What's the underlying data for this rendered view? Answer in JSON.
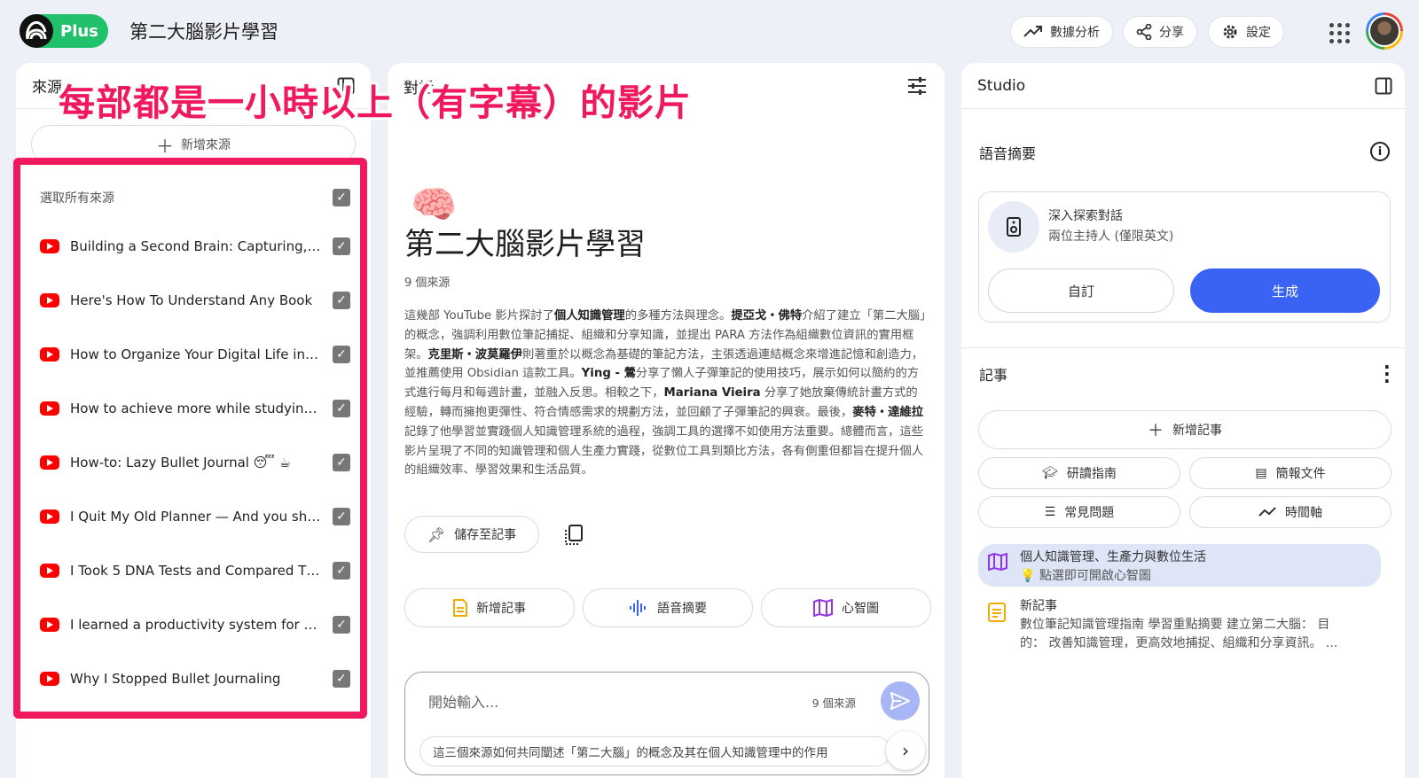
{
  "header": {
    "plan_badge": "Plus",
    "notebook_title": "第二大腦影片學習",
    "analytics_label": "數據分析",
    "share_label": "分享",
    "settings_label": "設定"
  },
  "overlay_caption": "每部都是一小時以上（有字幕）的影片",
  "sources_panel": {
    "title": "來源",
    "add_label": "新增來源",
    "select_all_label": "選取所有來源",
    "items": [
      {
        "label": "Building a Second Brain: Capturing, ...",
        "checked": true
      },
      {
        "label": "Here's How To Understand Any Book",
        "checked": true
      },
      {
        "label": "How to Organize Your Digital Life in S...",
        "checked": true
      },
      {
        "label": "How to achieve more while studying l...",
        "checked": true
      },
      {
        "label": "How-to: Lazy Bullet Journal 😴 ☕",
        "checked": true
      },
      {
        "label": "I Quit My Old Planner — And you sho...",
        "checked": true
      },
      {
        "label": "I Took 5 DNA Tests and Compared Th...",
        "checked": true
      },
      {
        "label": "I learned a productivity system for or...",
        "checked": true
      },
      {
        "label": "Why I Stopped Bullet Journaling",
        "checked": true
      }
    ]
  },
  "chat_panel": {
    "title": "對話",
    "emoji": "🧠",
    "notebook_title": "第二大腦影片學習",
    "source_count": "9 個來源",
    "summary_segments": [
      {
        "t": "這幾部 YouTube 影片探討了",
        "b": false
      },
      {
        "t": "個人知識管理",
        "b": true
      },
      {
        "t": "的多種方法與理念。",
        "b": false
      },
      {
        "t": "提亞戈・佛特",
        "b": true
      },
      {
        "t": "介紹了建立「第二大腦」的概念，強調利用數位筆記捕捉、組織和分享知識，並提出 PARA 方法作為組織數位資訊的實用框架。",
        "b": false
      },
      {
        "t": "克里斯・波莫羅伊",
        "b": true
      },
      {
        "t": "則著重於以概念為基礎的筆記方法，主張透過連結概念來增進記憶和創造力，並推薦使用 Obsidian 這款工具。",
        "b": false
      },
      {
        "t": "Ying - 鶯",
        "b": true
      },
      {
        "t": "分享了懶人子彈筆記的使用技巧，展示如何以簡約的方式進行每月和每週計畫，並融入反思。相較之下，",
        "b": false
      },
      {
        "t": "Mariana Vieira",
        "b": true
      },
      {
        "t": " 分享了她放棄傳統計畫方式的經驗，轉而擁抱更彈性、符合情感需求的規劃方法，並回顧了子彈筆記的興衰。最後，",
        "b": false
      },
      {
        "t": "麥特・達維拉",
        "b": true
      },
      {
        "t": "記錄了他學習並實踐個人知識管理系統的過程，強調工具的選擇不如使用方法重要。總體而言，這些影片呈現了不同的知識管理和個人生產力實踐，從數位工具到類比方法，各有側重但都旨在提升個人的組織效率、學習效果和生活品質。",
        "b": false
      }
    ],
    "save_note_label": "儲存至記事",
    "action_buttons": [
      "新增記事",
      "語音摘要",
      "心智圖"
    ],
    "input_placeholder": "開始輸入...",
    "input_source_count": "9 個來源",
    "suggestion": "這三個來源如何共同闡述「第二大腦」的概念及其在個人知識管理中的作用"
  },
  "studio_panel": {
    "title": "Studio",
    "audio_overview_title": "語音摘要",
    "audio_card_title": "深入探索對話",
    "audio_card_subtitle": "兩位主持人 (僅限英文)",
    "customize_label": "自訂",
    "generate_label": "生成",
    "notes_title": "記事",
    "add_note_label": "新增記事",
    "note_tools": [
      "研讀指南",
      "簡報文件",
      "常見問題",
      "時間軸"
    ],
    "notes": [
      {
        "title": "個人知識管理、生產力與數位生活",
        "subtitle": "💡 點選即可開啟心智圖"
      },
      {
        "title": "新記事",
        "line1": "數位筆記知識管理指南 學習重點摘要 建立第二大腦： 目",
        "line2": "的： 改善知識管理，更高效地捕捉、組織和分享資訊。 ..."
      }
    ]
  },
  "colors": {
    "accent_blue": "#3a63f3",
    "annotation_pink": "#f0195e",
    "youtube_red": "#ff0000",
    "brand_green": "#21c16b"
  }
}
